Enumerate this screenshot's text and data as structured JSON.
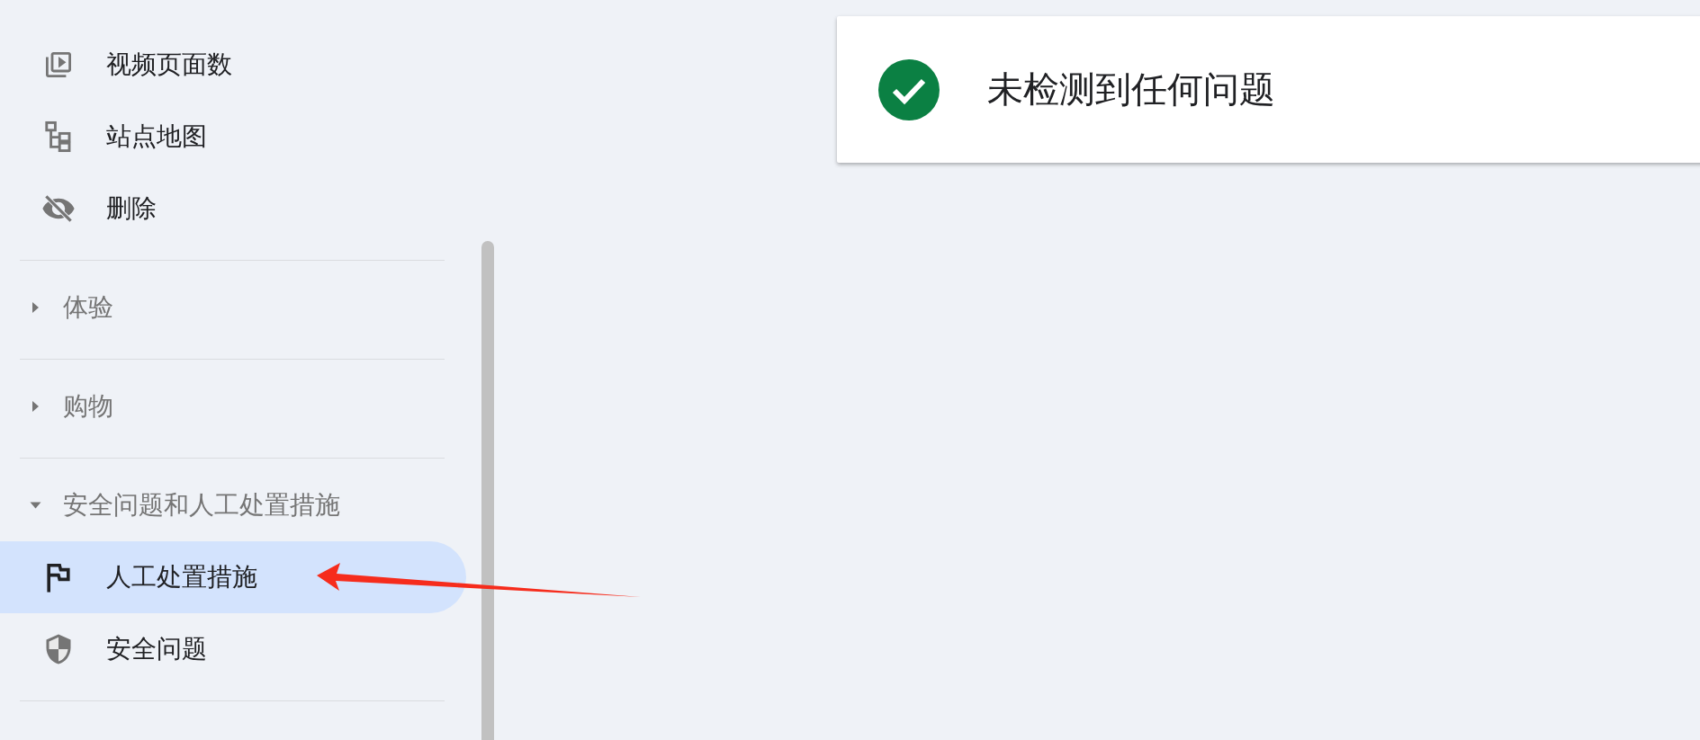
{
  "sidebar": {
    "items": [
      {
        "label": "视频页面数",
        "selected": false
      },
      {
        "label": "站点地图",
        "selected": false
      },
      {
        "label": "删除",
        "selected": false
      }
    ],
    "sections": [
      {
        "label": "体验",
        "expanded": false
      },
      {
        "label": "购物",
        "expanded": false
      },
      {
        "label": "安全问题和人工处置措施",
        "expanded": true,
        "items": [
          {
            "label": "人工处置措施",
            "selected": true
          },
          {
            "label": "安全问题",
            "selected": false
          }
        ]
      }
    ]
  },
  "status_card": {
    "text": "未检测到任何问题"
  }
}
